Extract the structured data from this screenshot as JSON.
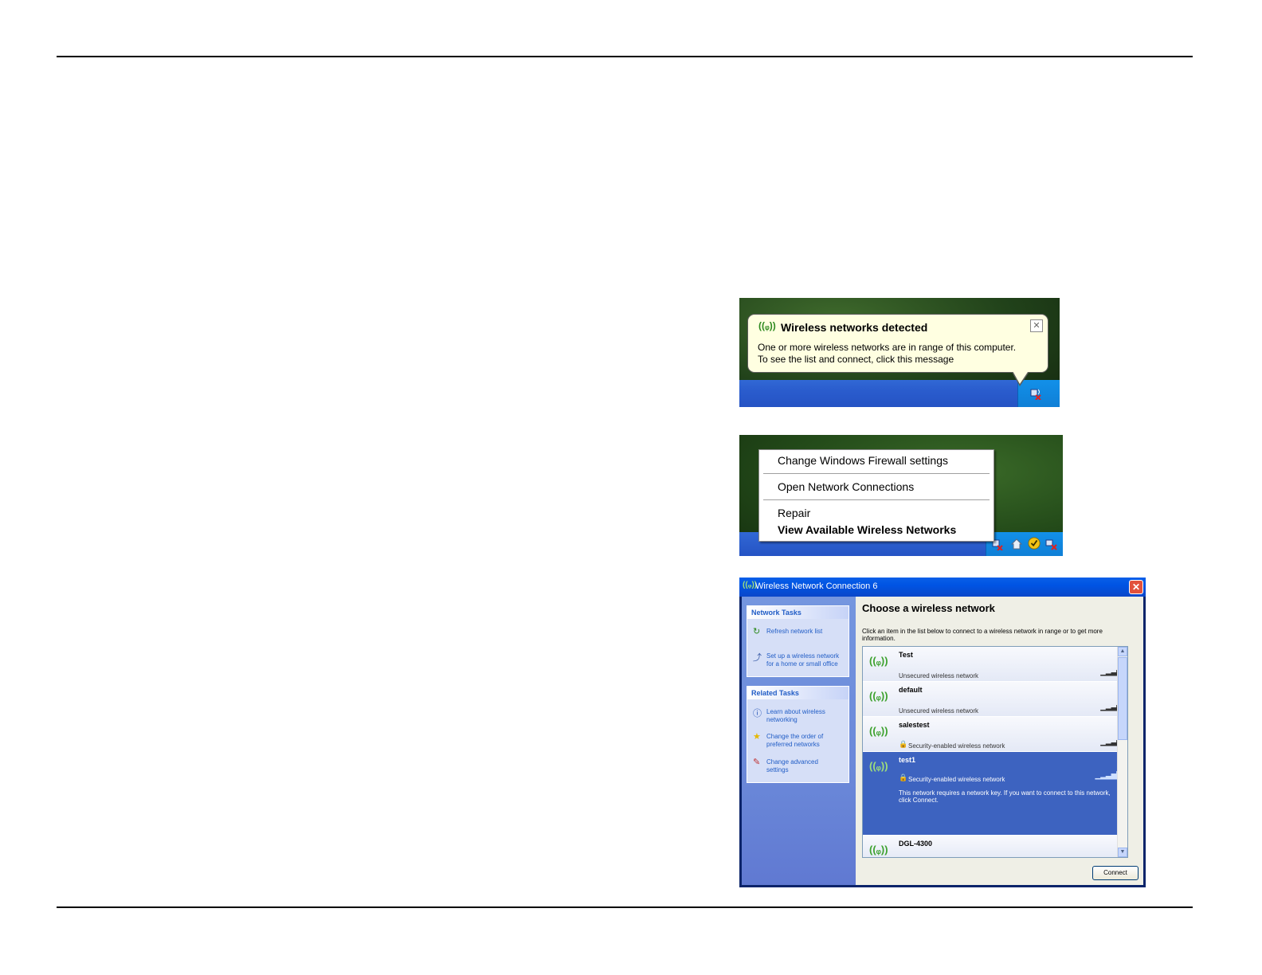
{
  "balloon": {
    "title": "Wireless networks detected",
    "line1": "One or more wireless networks are in range of this computer.",
    "line2": "To see the list and connect, click this message",
    "close": "✕"
  },
  "context_menu": {
    "items": [
      {
        "label": "Change Windows Firewall settings"
      },
      {
        "label": "Open Network Connections"
      },
      {
        "label": "Repair"
      },
      {
        "label": "View Available Wireless Networks"
      }
    ]
  },
  "dialog": {
    "title": "Wireless Network Connection 6",
    "close": "✕",
    "network_tasks": {
      "header": "Network Tasks",
      "items": [
        {
          "label": "Refresh network list",
          "icon": "refresh-icon"
        },
        {
          "label": "Set up a wireless network for a home or small office",
          "icon": "setup-wireless-icon"
        }
      ]
    },
    "related_tasks": {
      "header": "Related Tasks",
      "items": [
        {
          "label": "Learn about wireless networking",
          "icon": "info-icon"
        },
        {
          "label": "Change the order of preferred networks",
          "icon": "star-icon"
        },
        {
          "label": "Change advanced settings",
          "icon": "settings-icon"
        }
      ]
    },
    "heading": "Choose a wireless network",
    "instructions": "Click an item in the list below to connect to a wireless network in range or to get more information.",
    "networks": [
      {
        "name": "Test",
        "status": "Unsecured wireless network",
        "secured": false,
        "selected": false
      },
      {
        "name": "default",
        "status": "Unsecured wireless network",
        "secured": false,
        "selected": false
      },
      {
        "name": "salestest",
        "status": "Security-enabled wireless network",
        "secured": true,
        "selected": false
      },
      {
        "name": "test1",
        "status": "Security-enabled wireless network",
        "secured": true,
        "selected": true,
        "description": "This network requires a network key. If you want to connect to this network, click Connect."
      },
      {
        "name": "DGL-4300",
        "status": "",
        "secured": false,
        "selected": false
      }
    ],
    "connect_button": "Connect"
  }
}
